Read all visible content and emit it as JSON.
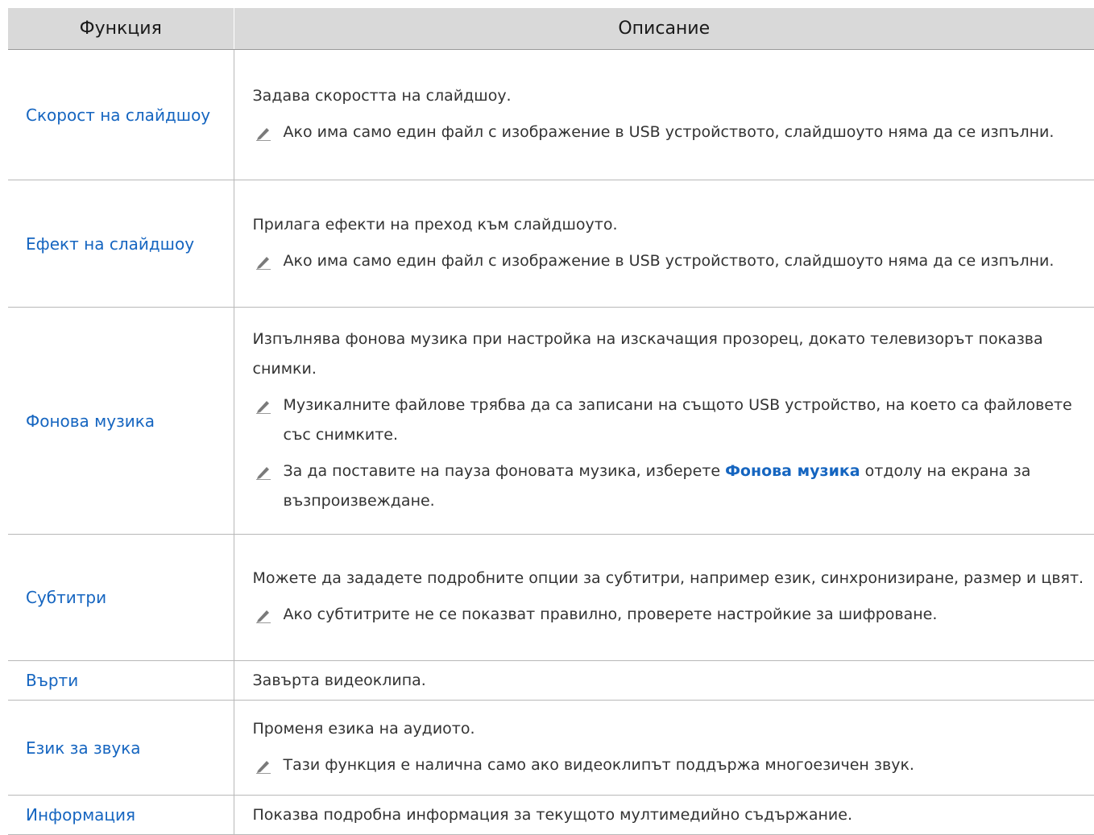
{
  "table": {
    "headers": [
      "Функция",
      "Описание"
    ],
    "rows": [
      {
        "function": "Скорост на слайдшоу",
        "description": "Задава скоростта на слайдшоу.",
        "notes": [
          "Ако има само един файл с изображение в USB устройството, слайдшоуто няма да се изпълни."
        ]
      },
      {
        "function": "Ефект на слайдшоу",
        "description": "Прилага ефекти на преход към слайдшоуто.",
        "notes": [
          "Ако има само един файл с изображение в USB устройството, слайдшоуто няма да се изпълни."
        ]
      },
      {
        "function": "Фонова музика",
        "description": "Изпълнява фонова музика при настройка на изскачащия прозорец, докато телевизорът показва снимки.",
        "notes": [
          "Музикалните файлове трябва да са записани на същото USB устройство, на което са файловете със снимките.",
          {
            "before": "За да поставите на пауза фоновата музика, изберете ",
            "highlight": "Фонова музика",
            "after": " отдолу на екрана за възпроизвеждане."
          }
        ]
      },
      {
        "function": "Субтитри",
        "description": "Можете да зададете подробните опции за субтитри, например език, синхронизиране, размер и цвят.",
        "notes": [
          "Ако субтитрите не се показват правилно, проверете настройкие за шифроване."
        ]
      },
      {
        "function": "Върти",
        "description": "Завърта видеоклипа.",
        "notes": []
      },
      {
        "function": "Език за звука",
        "description": "Променя езика на аудиото.",
        "notes": [
          "Тази функция е налична само ако видеоклипът поддържа многоезичен звук."
        ]
      },
      {
        "function": "Информация",
        "description": "Показва подробна информация за текущото мултимедийно съдържание.",
        "notes": []
      }
    ]
  },
  "icons": {
    "note": "pencil-icon"
  },
  "colors": {
    "link": "#1565c0",
    "header_bg": "#d9d9d9",
    "text": "#333333",
    "border": "#b8b8b8"
  }
}
